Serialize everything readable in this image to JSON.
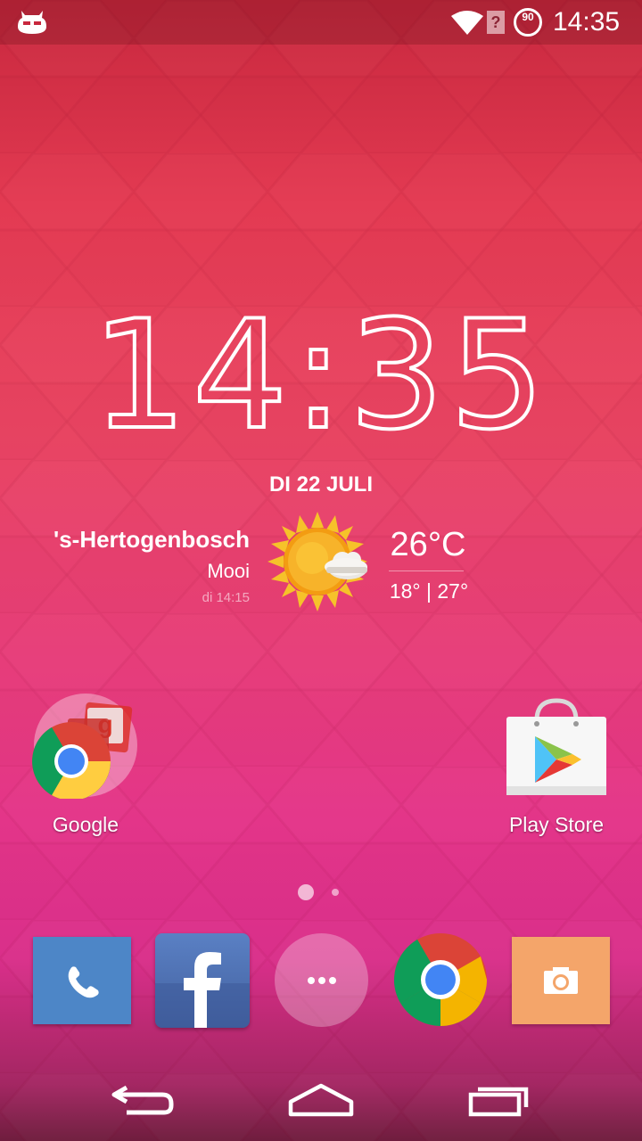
{
  "status_bar": {
    "battery_level": "90",
    "time": "14:35",
    "icons": [
      "cyanogenmod-robot-icon",
      "wifi-icon",
      "no-sim-icon",
      "battery-icon"
    ]
  },
  "clock_widget": {
    "time": "14:35",
    "date": "DI 22 JULI"
  },
  "weather_widget": {
    "city": "'s-Hertogenbosch",
    "condition": "Mooi",
    "updated": "di 14:15",
    "temperature": "26°C",
    "range": "18° | 27°",
    "icon": "sun-cloud-icon"
  },
  "home_apps": [
    {
      "label": "Google",
      "icon": "google-folder-icon"
    },
    {
      "label": "Play Store",
      "icon": "play-store-icon"
    }
  ],
  "page_indicator": {
    "pages": 2,
    "current": 1
  },
  "dock": [
    {
      "name": "Phone",
      "icon": "phone-icon",
      "color": "#4d86c7"
    },
    {
      "name": "Facebook",
      "icon": "facebook-icon",
      "color": "#4a69a8"
    },
    {
      "name": "App drawer",
      "icon": "app-drawer-icon"
    },
    {
      "name": "Chrome",
      "icon": "chrome-icon"
    },
    {
      "name": "Camera",
      "icon": "camera-icon",
      "color": "#f4a56a"
    }
  ],
  "navigation": [
    "back-icon",
    "home-icon",
    "recents-icon"
  ]
}
